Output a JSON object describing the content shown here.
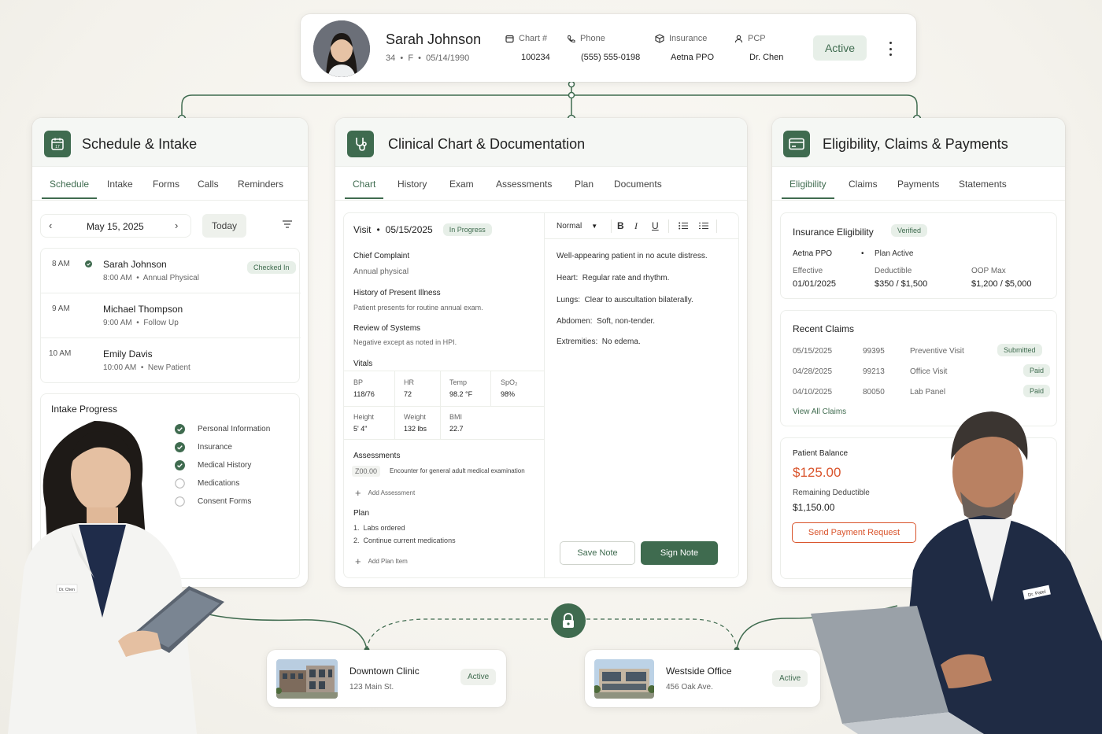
{
  "patient": {
    "name": "Sarah Johnson",
    "age": "34",
    "sex": "F",
    "dob": "05/14/1990",
    "chart_label": "Chart #",
    "chart_value": "100234",
    "phone_label": "Phone",
    "phone_value": "(555) 555-0198",
    "insurance_label": "Insurance",
    "insurance_value": "Aetna PPO",
    "pcp_label": "PCP",
    "pcp_value": "Dr. Chen",
    "status": "Active"
  },
  "schedule": {
    "title": "Schedule & Intake",
    "tabs": [
      "Schedule",
      "Intake",
      "Forms",
      "Calls",
      "Reminders"
    ],
    "date": "May 15, 2025",
    "today_label": "Today",
    "appointments": [
      {
        "time": "8 AM",
        "name": "Sarah Johnson",
        "detail_time": "8:00 AM",
        "type": "Annual Physical",
        "badge": "Checked In"
      },
      {
        "time": "9 AM",
        "name": "Michael Thompson",
        "detail_time": "9:00 AM",
        "type": "Follow Up"
      },
      {
        "time": "10 AM",
        "name": "Emily Davis",
        "detail_time": "10:00 AM",
        "type": "New Patient"
      }
    ],
    "intake_title": "Intake Progress",
    "intake_items": [
      {
        "label": "Personal Information",
        "done": true
      },
      {
        "label": "Insurance",
        "done": true
      },
      {
        "label": "Medical History",
        "done": true
      },
      {
        "label": "Medications",
        "done": false
      },
      {
        "label": "Consent Forms",
        "done": false
      }
    ]
  },
  "clinical": {
    "title": "Clinical Chart & Documentation",
    "tabs": [
      "Chart",
      "History",
      "Exam",
      "Assessments",
      "Plan",
      "Documents"
    ],
    "visit_label": "Visit",
    "visit_date": "05/15/2025",
    "visit_status": "In Progress",
    "chief_complaint_label": "Chief Complaint",
    "chief_complaint": "Annual physical",
    "hpi_label": "History of Present Illness",
    "hpi": "Patient presents for routine annual exam.",
    "ros_label": "Review of Systems",
    "ros": "Negative except as noted in HPI.",
    "vitals_label": "Vitals",
    "vitals": [
      {
        "label": "BP",
        "value": "118/76"
      },
      {
        "label": "HR",
        "value": "72"
      },
      {
        "label": "Temp",
        "value": "98.2 °F"
      },
      {
        "label": "SpO₂",
        "value": "98%"
      },
      {
        "label": "Height",
        "value": "5' 4\""
      },
      {
        "label": "Weight",
        "value": "132 lbs"
      },
      {
        "label": "BMI",
        "value": "22.7"
      }
    ],
    "assessments_label": "Assessments",
    "assessment_code": "Z00.00",
    "assessment_desc": "Encounter for general adult medical examination",
    "add_assessment": "Add Assessment",
    "plan_label": "Plan",
    "plan_items": [
      "1.  Labs ordered",
      "2.  Continue current medications"
    ],
    "add_plan": "Add Plan Item",
    "editor_style": "Normal",
    "note_lines": [
      "Well-appearing patient in no acute distress.",
      "Heart:  Regular rate and rhythm.",
      "Lungs:  Clear to auscultation bilaterally.",
      "Abdomen:  Soft, non-tender.",
      "Extremities:  No edema."
    ],
    "save_note": "Save Note",
    "sign_note": "Sign Note"
  },
  "billing": {
    "title": "Eligibility, Claims & Payments",
    "tabs": [
      "Eligibility",
      "Claims",
      "Payments",
      "Statements"
    ],
    "elig_title": "Insurance Eligibility",
    "elig_badge": "Verified",
    "plan_name": "Aetna PPO",
    "plan_status": "Plan Active",
    "effective_label": "Effective",
    "effective_value": "01/01/2025",
    "deductible_label": "Deductible",
    "deductible_value": "$350 / $1,500",
    "oop_label": "OOP Max",
    "oop_value": "$1,200 / $5,000",
    "claims_title": "Recent Claims",
    "claims": [
      {
        "date": "05/15/2025",
        "code": "99395",
        "desc": "Preventive Visit",
        "status": "Submitted"
      },
      {
        "date": "04/28/2025",
        "code": "99213",
        "desc": "Office Visit",
        "status": "Paid"
      },
      {
        "date": "04/10/2025",
        "code": "80050",
        "desc": "Lab Panel",
        "status": "Paid"
      }
    ],
    "view_all": "View All Claims",
    "balance_label": "Patient Balance",
    "balance_value": "$125.00",
    "remaining_label": "Remaining Deductible",
    "remaining_value": "$1,150.00",
    "send_request": "Send Payment Request"
  },
  "locations": [
    {
      "name": "Downtown Clinic",
      "address": "123 Main St.",
      "status": "Active"
    },
    {
      "name": "Westside Office",
      "address": "456 Oak Ave.",
      "status": "Active"
    }
  ],
  "badges": {
    "doctor_left": "Dr. Chen",
    "doctor_right": "Dr. Patel"
  },
  "colors": {
    "accent": "#3f6b4f",
    "accent_light": "#e7efe8",
    "balance": "#d9542c"
  }
}
